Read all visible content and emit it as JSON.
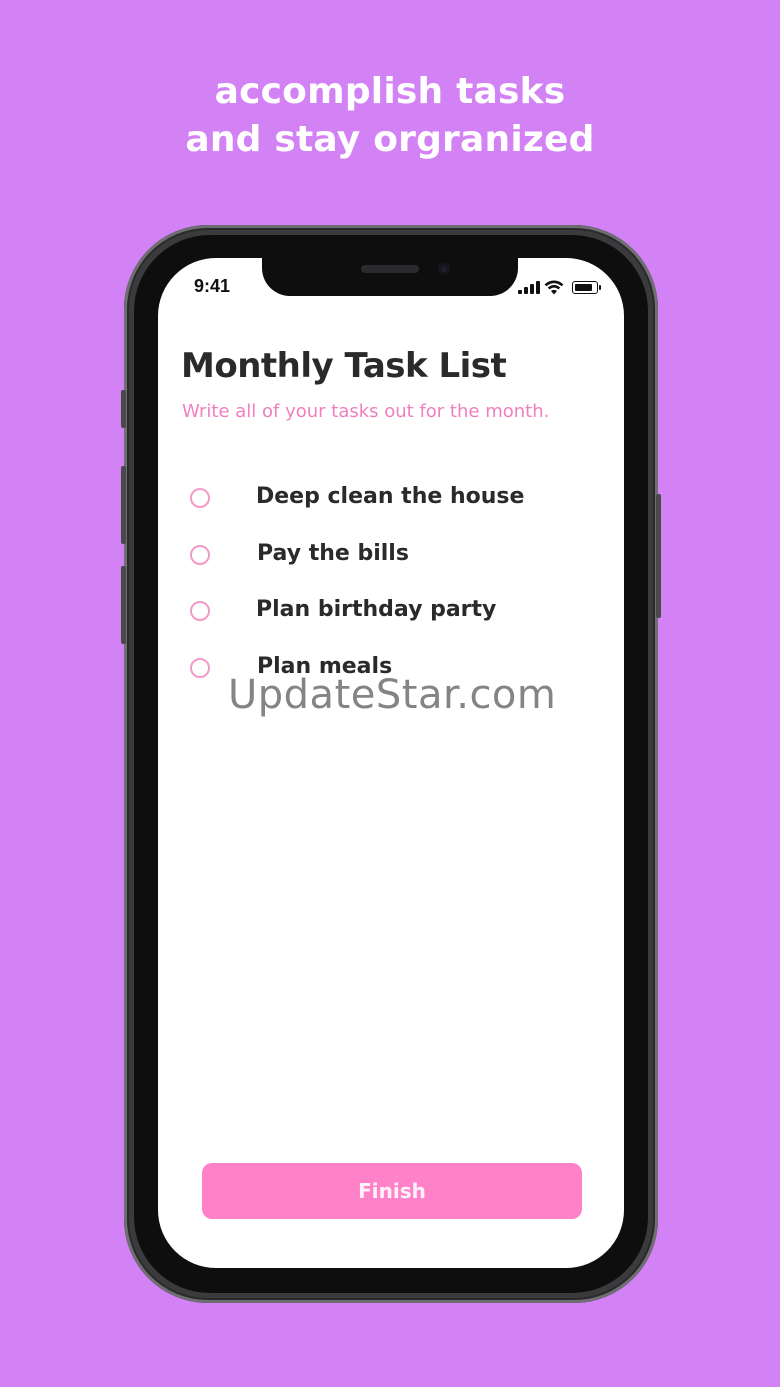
{
  "marketing": {
    "headline_line1": "accomplish tasks",
    "headline_line2": "and stay orgranized"
  },
  "status_bar": {
    "time": "9:41",
    "icons": [
      "cellular-signal-icon",
      "wifi-icon",
      "battery-icon"
    ]
  },
  "app": {
    "title": "Monthly Task List",
    "subtitle": "Write all of your tasks out for the month.",
    "tasks": [
      {
        "label": "Deep clean the house",
        "checked": false
      },
      {
        "label": "Pay the bills",
        "checked": false
      },
      {
        "label": "Plan birthday party",
        "checked": false
      },
      {
        "label": "Plan meals",
        "checked": false
      }
    ],
    "finish_label": "Finish"
  },
  "watermark": "UpdateStar.com",
  "colors": {
    "background": "#d382f5",
    "accent_pink": "#ff82c8",
    "subtitle_pink": "#f07fbf",
    "text_dark": "#2a2a2a"
  }
}
